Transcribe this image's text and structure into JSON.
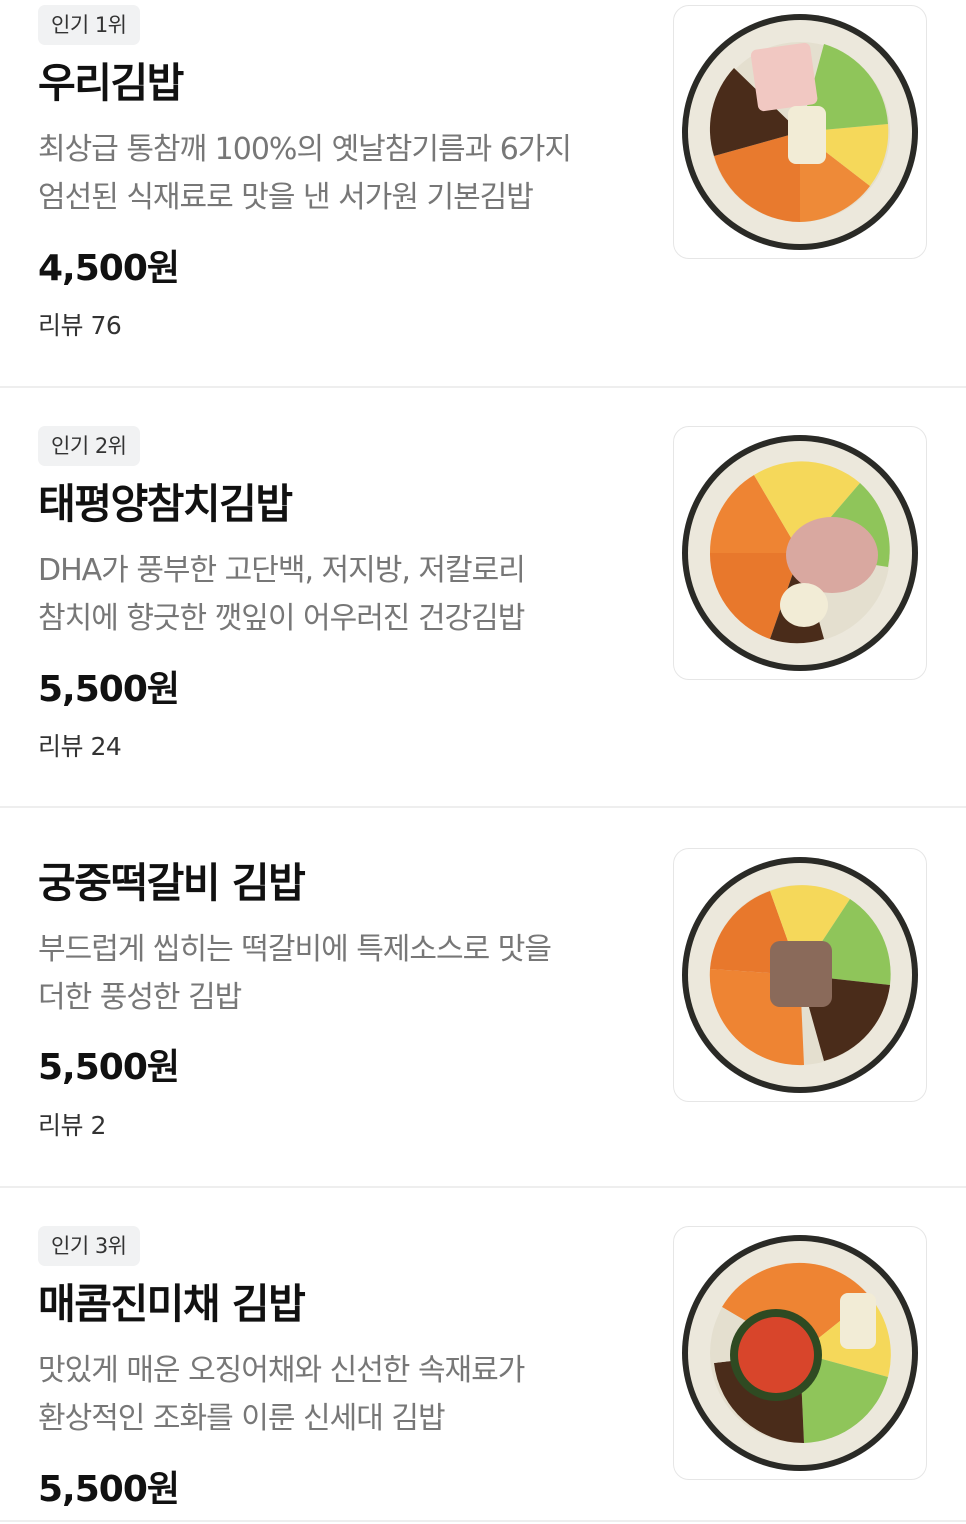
{
  "menu": {
    "items": [
      {
        "badge": "인기 1위",
        "name": "우리김밥",
        "desc_line1": "최상급 통참깨 100%의 옛날참기름과 6가지",
        "desc_line2": "엄선된 식재료로 맛을 낸 서가원 기본김밥",
        "price": "4,500원",
        "reviews": "리뷰 76",
        "image": "gimbap-woori-photo"
      },
      {
        "badge": "인기 2위",
        "name": "태평양참치김밥",
        "desc_line1": "DHA가 풍부한 고단백, 저지방, 저칼로리",
        "desc_line2": "참치에 향긋한 깻잎이 어우러진 건강김밥",
        "price": "5,500원",
        "reviews": "리뷰 24",
        "image": "gimbap-tuna-photo"
      },
      {
        "name": "궁중떡갈비 김밥",
        "desc_line1": "부드럽게 씹히는 떡갈비에 특제소스로 맛을",
        "desc_line2": "더한 풍성한 김밥",
        "price": "5,500원",
        "reviews": "리뷰 2",
        "image": "gimbap-tteokgalbi-photo"
      },
      {
        "badge": "인기 3위",
        "name": "매콤진미채 김밥",
        "desc_line1": "맛있게 매운 오징어채와 신선한 속재료가",
        "desc_line2": "환상적인 조화를 이룬 신세대 김밥",
        "price": "5,500원",
        "image": "gimbap-jinmichae-photo"
      }
    ]
  },
  "colors": {
    "badge_bg": "#f1f2f3",
    "desc_text": "#777777",
    "divider": "#eeeeee"
  }
}
